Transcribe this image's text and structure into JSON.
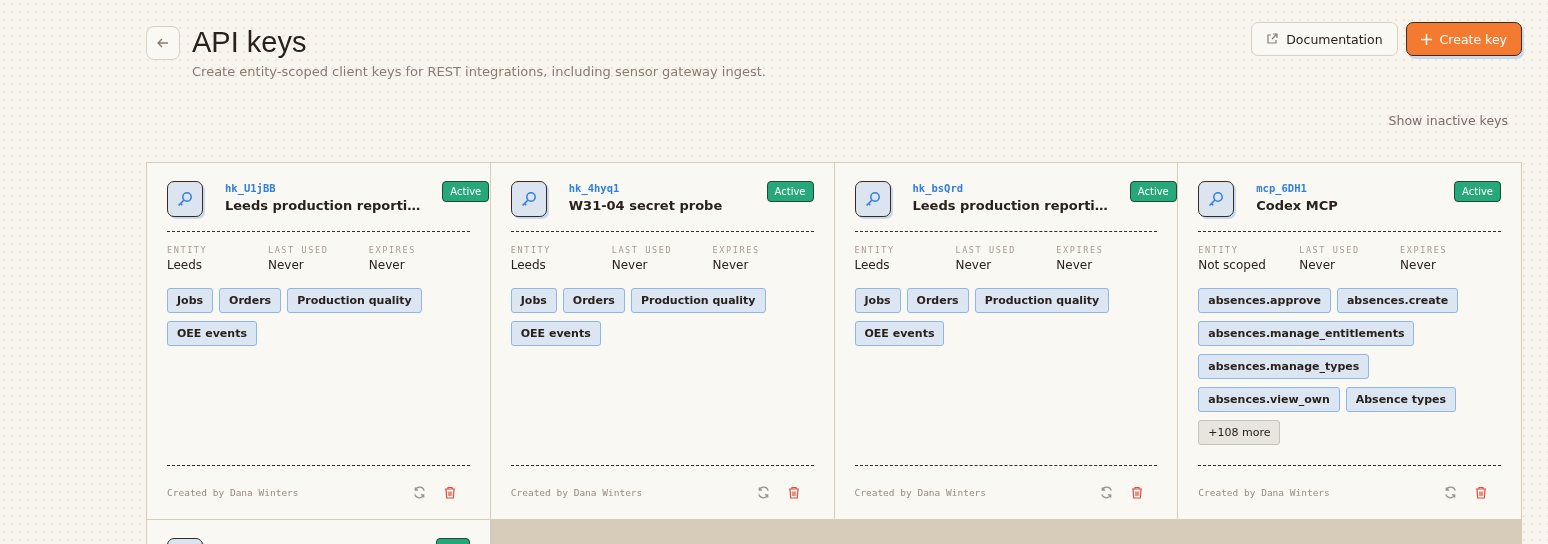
{
  "header": {
    "title": "API keys",
    "subtitle": "Create entity-scoped client keys for REST integrations, including sensor gateway ingest.",
    "actions": [
      {
        "kind": "secondary",
        "label": "Documentation"
      },
      {
        "kind": "primary",
        "label": "Create key"
      }
    ],
    "toggle": "Show inactive keys"
  },
  "keys": [
    {
      "kind": "full",
      "id": "hk_U1jBB",
      "name": "Leeds production reporti…",
      "status": "Active",
      "fields": [
        {
          "label": "ENTITY",
          "value": "Leeds"
        },
        {
          "label": "LAST USED",
          "value": "Never"
        },
        {
          "label": "EXPIRES",
          "value": "Never"
        }
      ],
      "tags": [
        {
          "kind": "scope",
          "label": "Jobs"
        },
        {
          "kind": "scope",
          "label": "Orders"
        },
        {
          "kind": "scope",
          "label": "Production quality"
        },
        {
          "kind": "scope",
          "label": "OEE events"
        }
      ],
      "created_by": "Created by Dana Winters"
    },
    {
      "kind": "full",
      "id": "hk_4hyq1",
      "name": "W31-04 secret probe",
      "status": "Active",
      "fields": [
        {
          "label": "ENTITY",
          "value": "Leeds"
        },
        {
          "label": "LAST USED",
          "value": "Never"
        },
        {
          "label": "EXPIRES",
          "value": "Never"
        }
      ],
      "tags": [
        {
          "kind": "scope",
          "label": "Jobs"
        },
        {
          "kind": "scope",
          "label": "Orders"
        },
        {
          "kind": "scope",
          "label": "Production quality"
        },
        {
          "kind": "scope",
          "label": "OEE events"
        }
      ],
      "created_by": "Created by Dana Winters"
    },
    {
      "kind": "full",
      "id": "hk_bsQrd",
      "name": "Leeds production reporti…",
      "status": "Active",
      "fields": [
        {
          "label": "ENTITY",
          "value": "Leeds"
        },
        {
          "label": "LAST USED",
          "value": "Never"
        },
        {
          "label": "EXPIRES",
          "value": "Never"
        }
      ],
      "tags": [
        {
          "kind": "scope",
          "label": "Jobs"
        },
        {
          "kind": "scope",
          "label": "Orders"
        },
        {
          "kind": "scope",
          "label": "Production quality"
        },
        {
          "kind": "scope",
          "label": "OEE events"
        }
      ],
      "created_by": "Created by Dana Winters"
    },
    {
      "kind": "full",
      "id": "mcp_6DH1",
      "name": "Codex MCP",
      "status": "Active",
      "fields": [
        {
          "label": "ENTITY",
          "value": "Not scoped"
        },
        {
          "label": "LAST USED",
          "value": "Never"
        },
        {
          "label": "EXPIRES",
          "value": "Never"
        }
      ],
      "tags": [
        {
          "kind": "scope",
          "label": "absences.approve"
        },
        {
          "kind": "scope",
          "label": "absences.create"
        },
        {
          "kind": "scope",
          "label": "absences.manage_entitlements"
        },
        {
          "kind": "scope",
          "label": "absences.manage_types"
        },
        {
          "kind": "scope",
          "label": "absences.view_own"
        },
        {
          "kind": "scope",
          "label": "Absence types"
        },
        {
          "kind": "more",
          "label": "+108 more"
        }
      ],
      "created_by": "Created by Dana Winters"
    },
    {
      "kind": "cut"
    }
  ]
}
